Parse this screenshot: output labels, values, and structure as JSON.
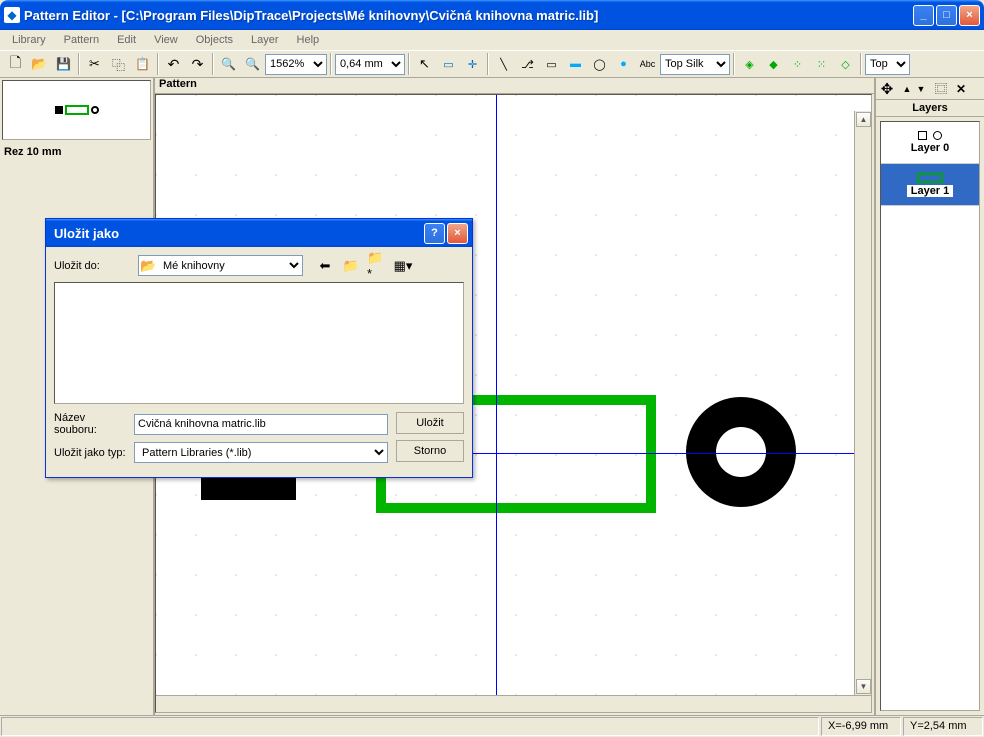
{
  "window": {
    "title": "Pattern Editor - [C:\\Program Files\\DipTrace\\Projects\\Mé knihovny\\Cvičná knihovna matric.lib]"
  },
  "menu": {
    "items": [
      "Library",
      "Pattern",
      "Edit",
      "View",
      "Objects",
      "Layer",
      "Help"
    ]
  },
  "toolbar": {
    "zoom": "1562%",
    "grid": "0,64 mm",
    "layer_dropdown": "Top Silk",
    "side_dropdown": "Top"
  },
  "left_panel": {
    "component_name": "Rez 10 mm"
  },
  "canvas": {
    "title": "Pattern"
  },
  "right_panel": {
    "title": "Layers",
    "layers": [
      {
        "name": "Layer 0",
        "selected": false
      },
      {
        "name": "Layer 1",
        "selected": true
      }
    ]
  },
  "statusbar": {
    "x": "X=-6,99 mm",
    "y": "Y=2,54 mm"
  },
  "dialog": {
    "title": "Uložit jako",
    "save_in_label": "Uložit do:",
    "save_in_value": "Mé knihovny",
    "filename_label1": "Název",
    "filename_label2": "souboru:",
    "filename_value": "Cvičná knihovna matric.lib",
    "filetype_label": "Uložit jako typ:",
    "filetype_value": "Pattern Libraries (*.lib)",
    "save_btn": "Uložit",
    "cancel_btn": "Storno"
  }
}
